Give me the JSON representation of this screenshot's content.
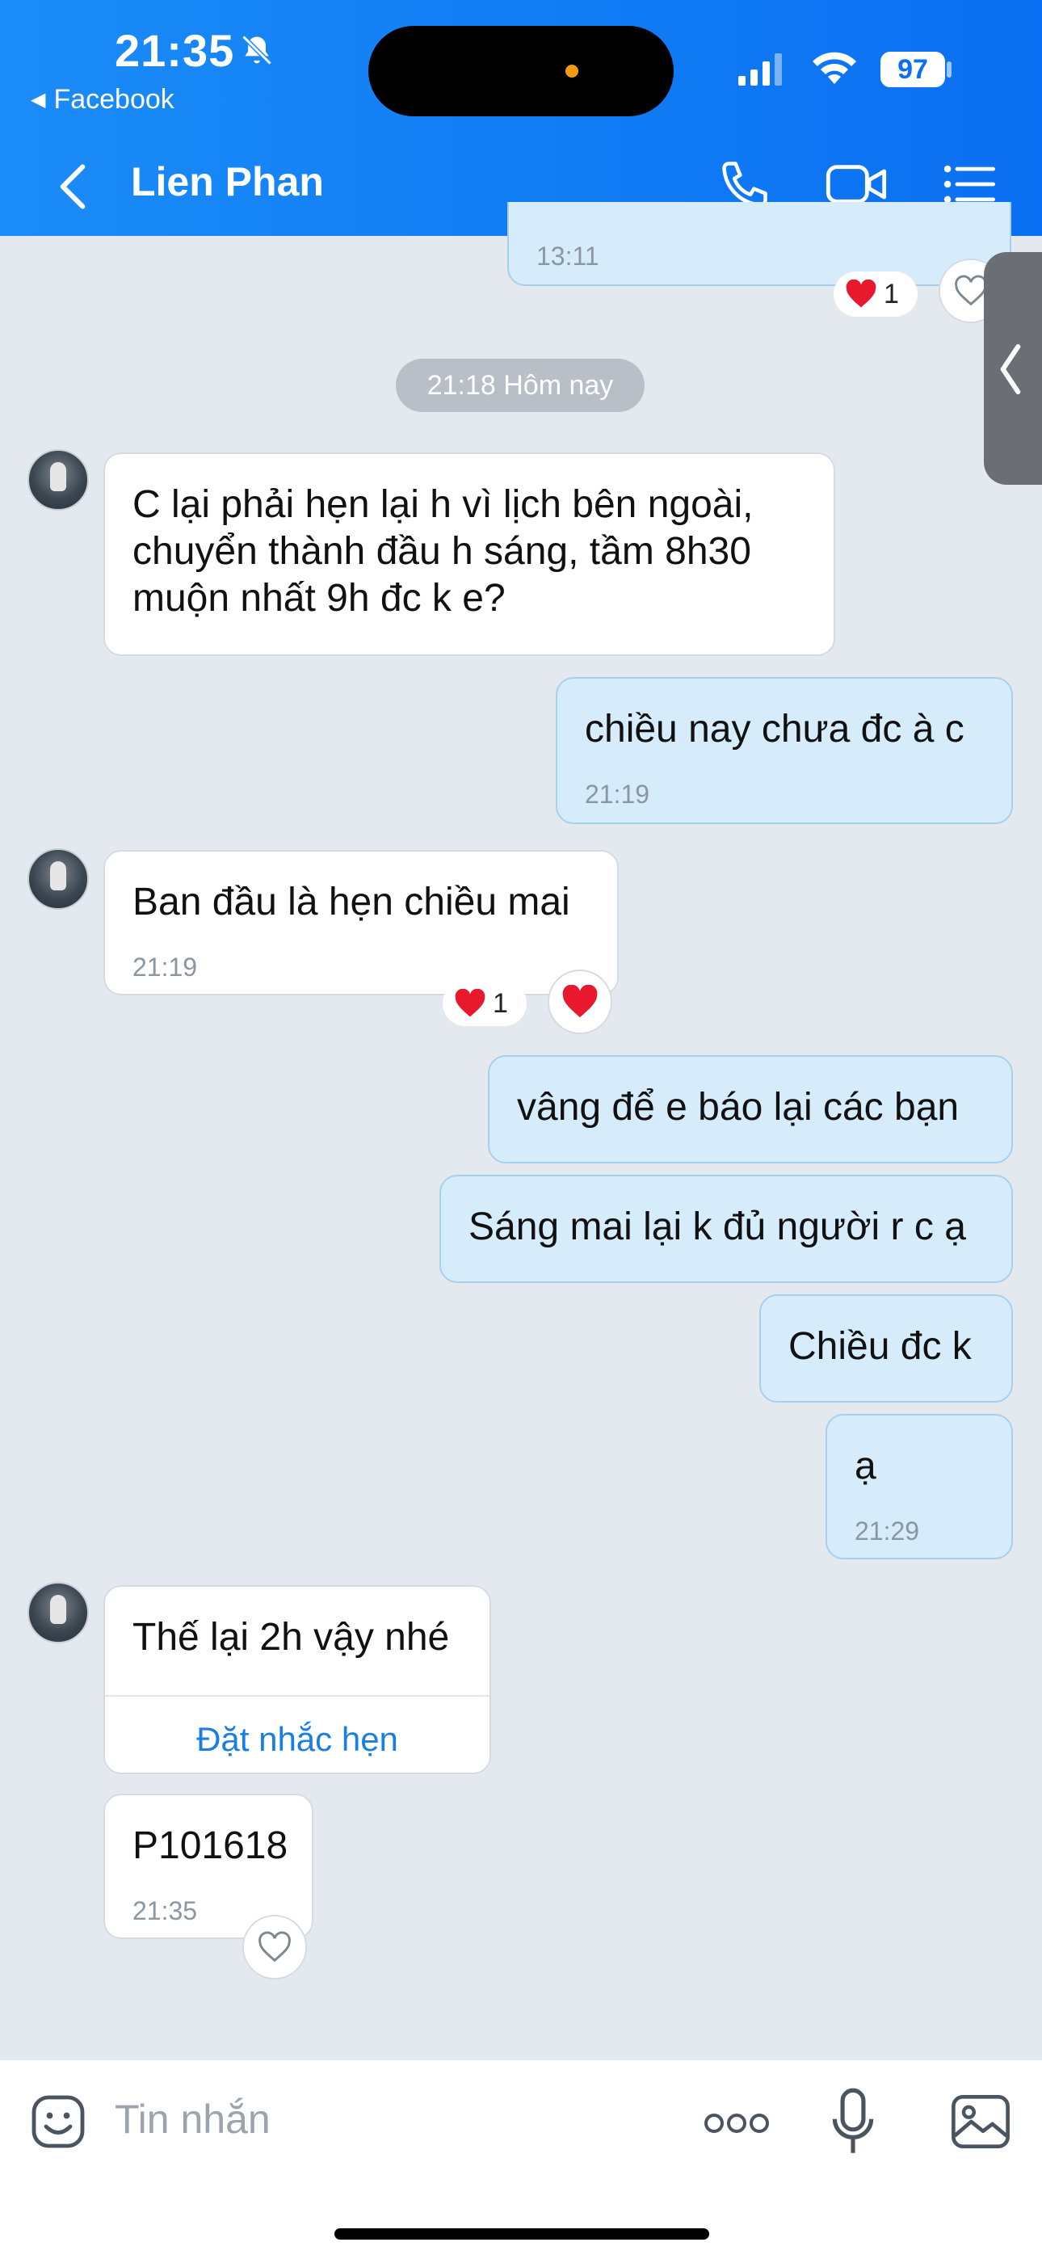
{
  "status_bar": {
    "time": "21:35",
    "back_app": "Facebook",
    "battery": "97"
  },
  "header": {
    "contact_name": "Lien Phan"
  },
  "messages": {
    "top_time": "13:11",
    "top_reaction_count": "1",
    "date_separator": "21:18 Hôm nay",
    "m1_line1": "C lại phải hẹn lại h vì lịch bên ngoài,",
    "m1_line2": "chuyển thành đầu h sáng, tầm 8h30",
    "m1_line3": "muộn nhất 9h đc k e?",
    "m2_text": "chiều nay chưa đc à c",
    "m2_time": "21:19",
    "m3_text": "Ban đầu là hẹn chiều mai",
    "m3_time": "21:19",
    "m3_reaction_count": "1",
    "m4_text": "vâng để e báo lại các bạn",
    "m5_text": "Sáng mai lại k đủ người r c ạ",
    "m6_text": "Chiều đc k",
    "m7_text": "ạ",
    "m7_time": "21:29",
    "m8_text": "Thế lại 2h vậy nhé",
    "m8_link": "Đặt nhắc hẹn",
    "m9_text": "P101618",
    "m9_time": "21:35"
  },
  "composer": {
    "placeholder": "Tin nhắn"
  },
  "colors": {
    "header_blue": "#0a6ff2",
    "sent_bubble": "#d6ecfb",
    "received_bubble": "#ffffff",
    "heart_red": "#e8192c",
    "link_blue": "#1a7fe0"
  },
  "icons": [
    "bell-slash-icon",
    "cellular-icon",
    "wifi-icon",
    "back-arrow-icon",
    "phone-icon",
    "video-icon",
    "menu-list-icon",
    "heart-icon",
    "sticker-icon",
    "more-icon",
    "mic-icon",
    "image-icon"
  ]
}
